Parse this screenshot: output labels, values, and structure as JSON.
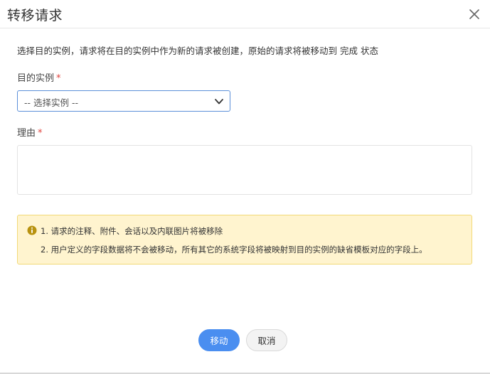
{
  "dialog": {
    "title": "转移请求",
    "description": "选择目的实例，请求将在目的实例中作为新的请求被创建，原始的请求将被移动到 完成 状态"
  },
  "form": {
    "instance_label": "目的实例",
    "instance_required_mark": "*",
    "instance_selected": "-- 选择实例 --",
    "reason_label": "理由",
    "reason_required_mark": "*",
    "reason_value": ""
  },
  "notice": {
    "line1": "1. 请求的注释、附件、会话以及内联图片将被移除",
    "line2": "2. 用户定义的字段数据将不会被移动，所有其它的系统字段将被映射到目的实例的缺省模板对应的字段上。",
    "icon": "info-icon",
    "icon_color": "#b8920f"
  },
  "buttons": {
    "move_label": "移动",
    "cancel_label": "取消"
  },
  "colors": {
    "primary": "#4a8ef0",
    "required": "#e0423c",
    "notice_bg": "#fff4cf",
    "notice_border": "#f2d977"
  }
}
